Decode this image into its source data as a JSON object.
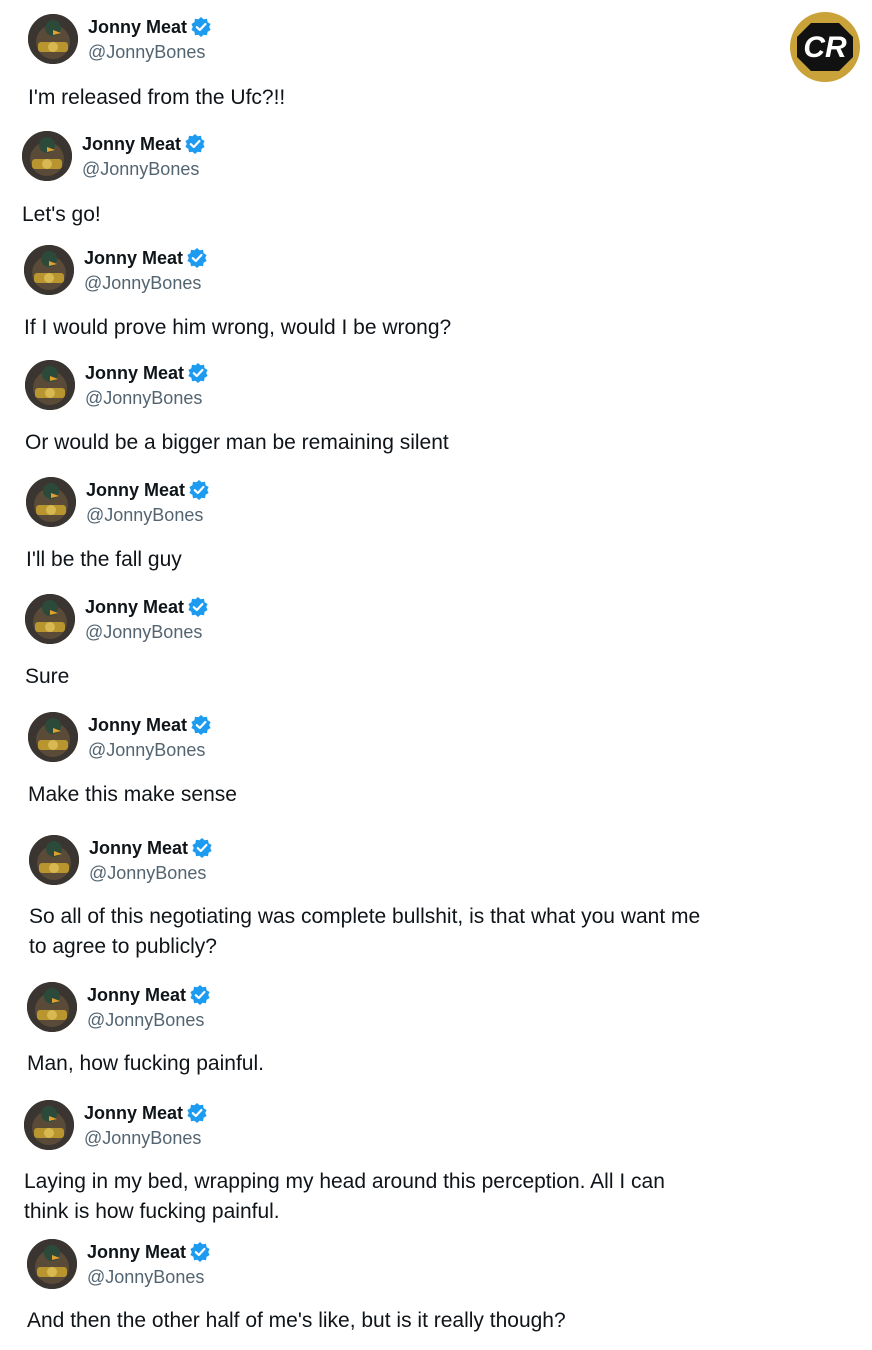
{
  "account": {
    "display_name": "Jonny Meat",
    "handle": "@JonnyBones"
  },
  "brand_logo": {
    "text": "CR",
    "ring_color": "#c9a23a",
    "fill_color": "#111111"
  },
  "colors": {
    "verified": "#1d9bf0",
    "handle": "#536471",
    "text": "#0f1419"
  },
  "icons": {
    "verified": "verified-badge-icon",
    "avatar": "avatar-image"
  },
  "tweets": [
    {
      "text": "I'm released from the Ufc?!!"
    },
    {
      "text": "Let's go!"
    },
    {
      "text": "If I would prove him wrong, would I be wrong?"
    },
    {
      "text": "Or would be a bigger man be remaining silent"
    },
    {
      "text": "I'll be the fall guy"
    },
    {
      "text": "Sure"
    },
    {
      "text": "Make this make sense"
    },
    {
      "text": "So all of this negotiating was complete bullshit, is that what you want me\nto agree to publicly?"
    },
    {
      "text": "Man, how fucking painful."
    },
    {
      "text": "Laying in my bed, wrapping my head around this perception. All I can\nthink is how fucking painful."
    },
    {
      "text": "And then the other half of me's like, but is it really though?"
    }
  ]
}
